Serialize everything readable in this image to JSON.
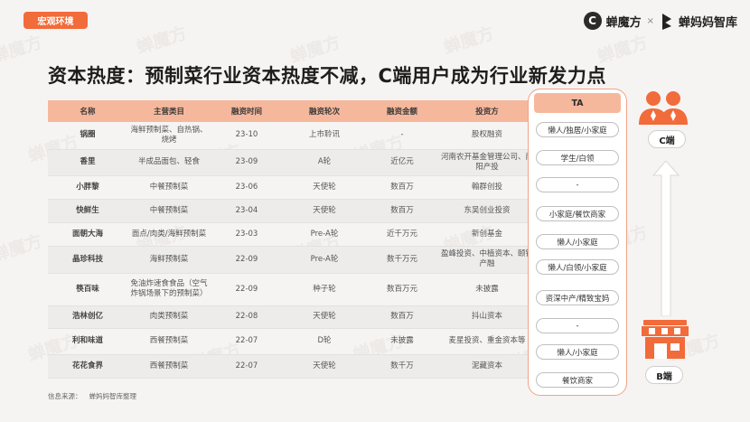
{
  "header": {
    "tag": "宏观环境",
    "logo1_text": "蝉魔方",
    "logo_x": "×",
    "logo2_text": "蝉妈妈智库"
  },
  "watermark": "蝉魔方",
  "title": "资本热度：预制菜行业资本热度不减，C端用户成为行业新发力点",
  "table": {
    "headers": [
      "名称",
      "主营类目",
      "融资时间",
      "融资轮次",
      "融资金额",
      "投资方"
    ],
    "rows": [
      {
        "name": "锅圈",
        "category": "海鲜预制菜、自热锅、烧烤",
        "time": "23-10",
        "round": "上市聆讯",
        "amount": "-",
        "investor": "股权融资"
      },
      {
        "name": "香里",
        "category": "半成品面包、轻食",
        "time": "23-09",
        "round": "A轮",
        "amount": "近亿元",
        "investor": "河南农开基金管理公司、南阳产投"
      },
      {
        "name": "小胖黎",
        "category": "中餐预制菜",
        "time": "23-06",
        "round": "天使轮",
        "amount": "数百万",
        "investor": "翰群创投"
      },
      {
        "name": "快鲜生",
        "category": "中餐预制菜",
        "time": "23-04",
        "round": "天使轮",
        "amount": "数百万",
        "investor": "东吴创业投资"
      },
      {
        "name": "面朝大海",
        "category": "面点/肉类/海鲜预制菜",
        "time": "23-03",
        "round": "Pre-A轮",
        "amount": "近千万元",
        "investor": "新创基金"
      },
      {
        "name": "晶珍科技",
        "category": "海鲜预制菜",
        "time": "22-09",
        "round": "Pre-A轮",
        "amount": "数千万元",
        "investor": "盈峰投资、中植资本、颐锁产融"
      },
      {
        "name": "筷百味",
        "category": "免油炸速食食品（空气炸锅场景下的预制菜）",
        "time": "22-09",
        "round": "种子轮",
        "amount": "数百万元",
        "investor": "未披露"
      },
      {
        "name": "浩林创亿",
        "category": "肉类预制菜",
        "time": "22-08",
        "round": "天使轮",
        "amount": "数百万",
        "investor": "抖山资本"
      },
      {
        "name": "利和味道",
        "category": "西餐预制菜",
        "time": "22-07",
        "round": "D轮",
        "amount": "未披露",
        "investor": "麦星投资、重金资本等"
      },
      {
        "name": "花花食界",
        "category": "西餐预制菜",
        "time": "22-07",
        "round": "天使轮",
        "amount": "数千万",
        "investor": "泥藏资本"
      }
    ]
  },
  "ta": {
    "header": "TA",
    "items": [
      "懒人/独居/小家庭",
      "学生/白领",
      "-",
      "小家庭/餐饮商家",
      "懒人/小家庭",
      "懒人/白领/小家庭",
      "资深中产/精致宝妈",
      "-",
      "懒人/小家庭",
      "餐饮商家"
    ]
  },
  "side": {
    "c_label": "C端",
    "b_label": "B端"
  },
  "source": {
    "label": "信息来源：",
    "value": "蝉妈妈智库整理"
  },
  "colors": {
    "accent": "#f26b3a",
    "header_bg": "#f6b89c",
    "panel_border": "#f0a288"
  }
}
